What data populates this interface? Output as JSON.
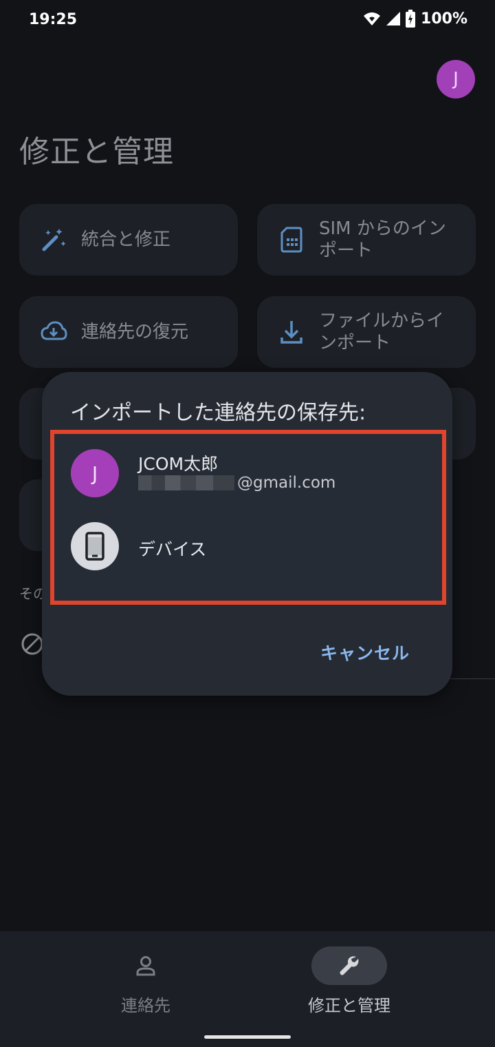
{
  "status_bar": {
    "time": "19:25",
    "battery": "100%"
  },
  "header": {
    "avatar_letter": "J",
    "title": "修正と管理"
  },
  "cards": {
    "merge": "統合と修正",
    "sim_import": [
      "SIM からのイン",
      "ポート"
    ],
    "restore": "連絡先の復元",
    "file_import": [
      "ファイルからイ",
      "ンポート"
    ]
  },
  "other_label": "その",
  "dialog": {
    "title": "インポートした連絡先の保存先:",
    "accounts": [
      {
        "avatar_letter": "J",
        "name": "JCOM太郎",
        "email_suffix": "@gmail.com"
      },
      {
        "name": "デバイス"
      }
    ],
    "cancel": "キャンセル"
  },
  "colors": {
    "highlight": "#e0442c",
    "accent": "#8ab7ee",
    "avatar": "#a53fb9"
  },
  "bottom_nav": {
    "items": [
      {
        "label": "連絡先",
        "icon": "person-icon",
        "active": false
      },
      {
        "label": "修正と管理",
        "icon": "wrench-icon",
        "active": true
      }
    ]
  }
}
